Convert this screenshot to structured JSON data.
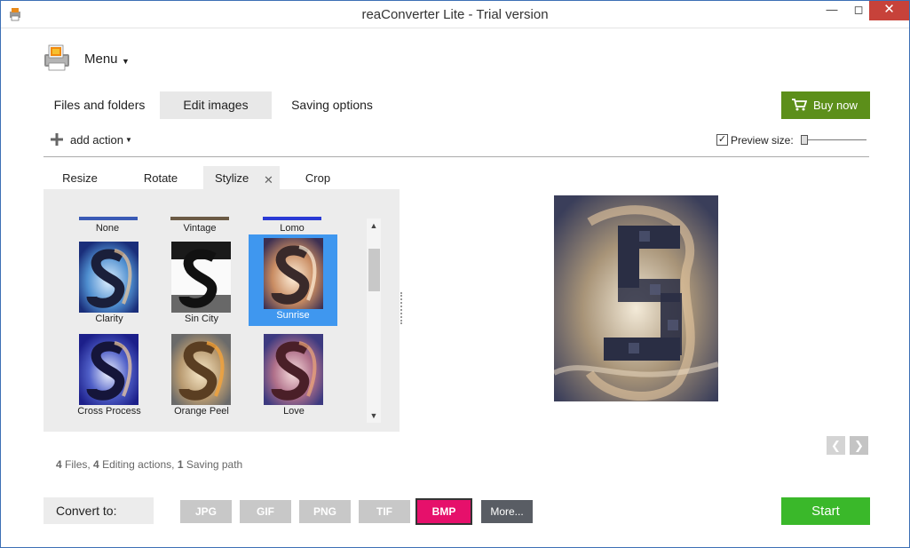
{
  "window": {
    "title": "reaConverter Lite - Trial version"
  },
  "menu": {
    "label": "Menu"
  },
  "main_tabs": [
    {
      "label": "Files and folders"
    },
    {
      "label": "Edit images"
    },
    {
      "label": "Saving options"
    }
  ],
  "buy_button": {
    "label": "Buy now"
  },
  "toolbar": {
    "add_action_label": "add action",
    "preview_size_label": "Preview size:",
    "preview_checked": true
  },
  "sub_tabs": [
    {
      "label": "Resize"
    },
    {
      "label": "Rotate"
    },
    {
      "label": "Stylize"
    },
    {
      "label": "Crop"
    }
  ],
  "styles_top_row": [
    {
      "label": "None"
    },
    {
      "label": "Vintage"
    },
    {
      "label": "Lomo"
    }
  ],
  "styles": [
    {
      "label": "Clarity"
    },
    {
      "label": "Sin City"
    },
    {
      "label": "Sunrise"
    },
    {
      "label": "Cross Process"
    },
    {
      "label": "Orange Peel"
    },
    {
      "label": "Love"
    }
  ],
  "selected_style": "Sunrise",
  "summary": {
    "files_count": "4",
    "files_label": "Files,",
    "actions_count": "4",
    "actions_label": "Editing actions,",
    "paths_count": "1",
    "paths_label": "Saving path"
  },
  "convert": {
    "label": "Convert to:",
    "formats": [
      {
        "label": "JPG"
      },
      {
        "label": "GIF"
      },
      {
        "label": "PNG"
      },
      {
        "label": "TIF"
      },
      {
        "label": "BMP"
      }
    ],
    "selected_format": "BMP",
    "more_label": "More..."
  },
  "start_button": {
    "label": "Start"
  },
  "colors": {
    "buy_green": "#5c8f1a",
    "start_green": "#3ab82a",
    "selected_format": "#e6106b",
    "selection_blue": "#3f97ef"
  },
  "icons": {
    "app": "app-printer-icon",
    "menu_logo": "printer-photo-icon",
    "cart": "shopping-cart-icon",
    "add": "plus-icon",
    "close": "close-icon",
    "prev": "chevron-left-icon",
    "next": "chevron-right-icon"
  }
}
